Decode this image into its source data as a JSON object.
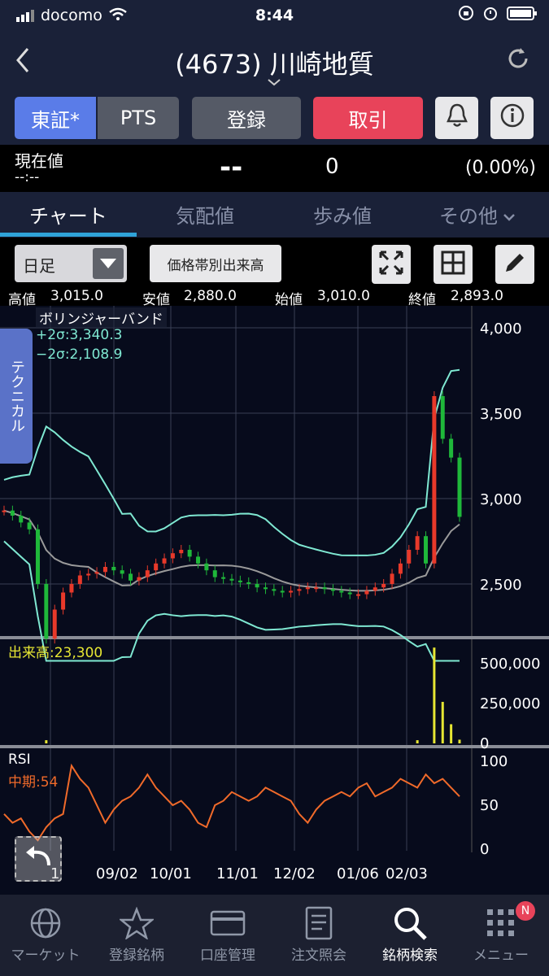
{
  "status_bar": {
    "carrier": "docomo",
    "time": "8:44"
  },
  "header": {
    "title": "(4673) 川崎地質"
  },
  "market_buttons": {
    "tse": "東証*",
    "pts": "PTS",
    "register": "登録",
    "trade": "取引"
  },
  "quote": {
    "label": "現在値",
    "time": "--:--",
    "price": "--",
    "change": "0",
    "change_pct": "(0.00%)"
  },
  "tabs": [
    "チャート",
    "気配値",
    "歩み値",
    "その他"
  ],
  "tools": {
    "period": "日足",
    "volume_profile": "価格帯別出来高"
  },
  "ohlc": {
    "high_label": "高値",
    "high": "3,015.0",
    "low_label": "安値",
    "low": "2,880.0",
    "open_label": "始値",
    "open": "3,010.0",
    "close_label": "終値",
    "close": "2,893.0"
  },
  "technical_tab": "テクニカル",
  "overlays": {
    "bollinger": "ボリンジャーバンド",
    "upper": "+2σ:3,340.3",
    "lower": "−2σ:2,108.9"
  },
  "volume_label": "出来高:23,300",
  "rsi": {
    "title": "RSI",
    "period": "中期:54"
  },
  "price_axis": [
    "4,000",
    "3,500",
    "3,000",
    "2,500"
  ],
  "volume_axis": [
    "500,000",
    "250,000",
    "0"
  ],
  "rsi_axis": [
    "100",
    "50",
    "0"
  ],
  "x_axis": [
    "1",
    "09/02",
    "10/01",
    "11/01",
    "12/02",
    "01/06",
    "02/03"
  ],
  "colors": {
    "up": "#e8392a",
    "down": "#1fb83a",
    "band": "#7fe8d2",
    "ma": "#9a9a9a",
    "volume": "#e6e633",
    "rsi": "#f06a2a",
    "accent": "#2fa3d8"
  },
  "bottom_nav": [
    "マーケット",
    "登録銘柄",
    "口座管理",
    "注文照会",
    "銘柄検索",
    "メニュー"
  ],
  "menu_badge": "N",
  "chart_data": {
    "type": "line",
    "series": [
      {
        "values": [
          2930,
          2900,
          2860,
          2820,
          2500,
          2180,
          2350,
          2450,
          2500,
          2550,
          2560,
          2570,
          2600,
          2580,
          2560,
          2520,
          2540,
          2580,
          2620,
          2650,
          2680,
          2700,
          2660,
          2620,
          2580,
          2540,
          2530,
          2520,
          2510,
          2500,
          2480,
          2470,
          2460,
          2450,
          2460,
          2470,
          2480,
          2480,
          2470,
          2460,
          2450,
          2440,
          2440,
          2460,
          2480,
          2500,
          2560,
          2620,
          2700,
          2780,
          2620,
          3600,
          3350,
          3240,
          2893
        ]
      }
    ],
    "volume": {
      "values": [
        0,
        0,
        0,
        0,
        0,
        20000,
        0,
        0,
        0,
        0,
        0,
        0,
        0,
        0,
        0,
        0,
        0,
        0,
        0,
        0,
        0,
        0,
        0,
        0,
        0,
        0,
        0,
        0,
        0,
        0,
        0,
        0,
        0,
        0,
        0,
        0,
        0,
        0,
        0,
        0,
        0,
        0,
        0,
        0,
        0,
        0,
        0,
        0,
        0,
        20000,
        0,
        600000,
        260000,
        120000,
        23300
      ]
    },
    "rsi": {
      "values": [
        40,
        30,
        35,
        20,
        10,
        25,
        35,
        40,
        95,
        80,
        70,
        50,
        30,
        45,
        55,
        60,
        70,
        85,
        70,
        60,
        50,
        55,
        45,
        30,
        25,
        50,
        55,
        65,
        60,
        55,
        60,
        70,
        65,
        60,
        55,
        40,
        30,
        45,
        55,
        60,
        65,
        60,
        70,
        75,
        60,
        65,
        70,
        80,
        75,
        70,
        85,
        75,
        80,
        70,
        60
      ]
    },
    "ylim": [
      2000,
      4000
    ],
    "grid": true
  }
}
